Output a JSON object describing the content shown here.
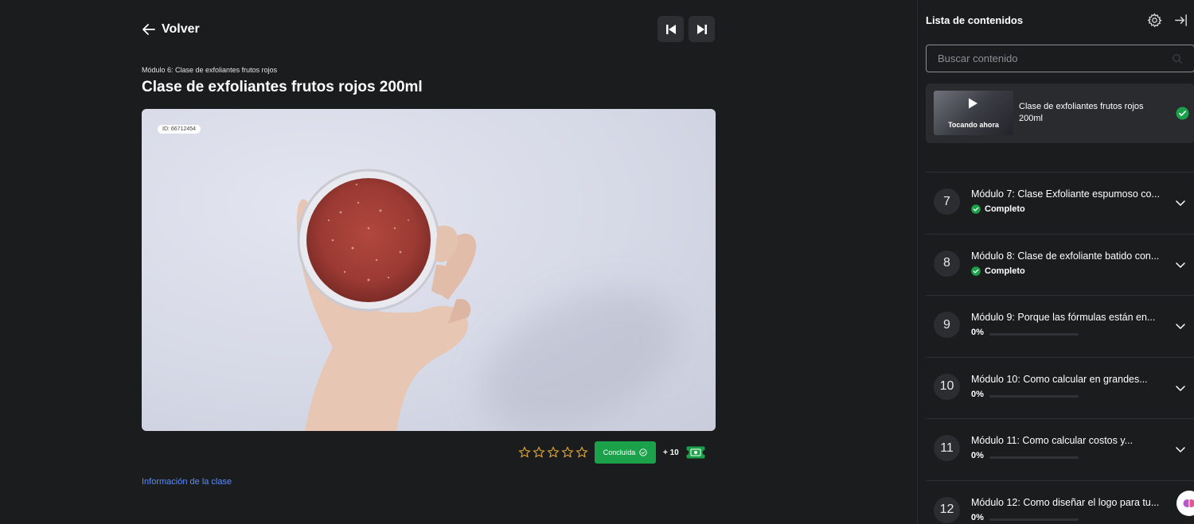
{
  "header": {
    "back_label": "Volver"
  },
  "lesson": {
    "module_subtitle": "Módulo 6: Clase de exfoliantes frutos rojos",
    "title": "Clase de exfoliantes frutos rojos 200ml",
    "video_id": "ID: 66712454"
  },
  "actions": {
    "rating_stars": 5,
    "rating_value": 0,
    "done_label": "Concluída",
    "points_label": "+ 10",
    "info_link": "Información de la clase"
  },
  "colors": {
    "accent_green": "#1aa14a",
    "link_blue": "#5a8cff",
    "star_gold": "#e0a83a",
    "background": "#1b1c1e"
  },
  "sidebar": {
    "title": "Lista de contenidos",
    "search_placeholder": "Buscar contenido",
    "current": {
      "thumb_label": "Tocando ahora",
      "title": "Clase de exfoliantes frutos rojos 200ml"
    },
    "modules": [
      {
        "number": "7",
        "title": "Módulo 7: Clase Exfoliante espumoso co...",
        "status": "complete",
        "status_label": "Completo",
        "progress": 1.0
      },
      {
        "number": "8",
        "title": "Módulo 8: Clase de exfoliante batido con...",
        "status": "complete",
        "status_label": "Completo",
        "progress": 1.0
      },
      {
        "number": "9",
        "title": "Módulo 9: Porque las fórmulas están en...",
        "status": "progress",
        "status_label": "0%",
        "progress": 0
      },
      {
        "number": "10",
        "title": "Módulo 10: Como calcular en grandes...",
        "status": "progress",
        "status_label": "0%",
        "progress": 0
      },
      {
        "number": "11",
        "title": "Módulo 11: Como calcular costos y...",
        "status": "progress",
        "status_label": "0%",
        "progress": 0
      },
      {
        "number": "12",
        "title": "Módulo 12: Como diseñar el logo para tu...",
        "status": "progress",
        "status_label": "0%",
        "progress": 0
      }
    ]
  }
}
